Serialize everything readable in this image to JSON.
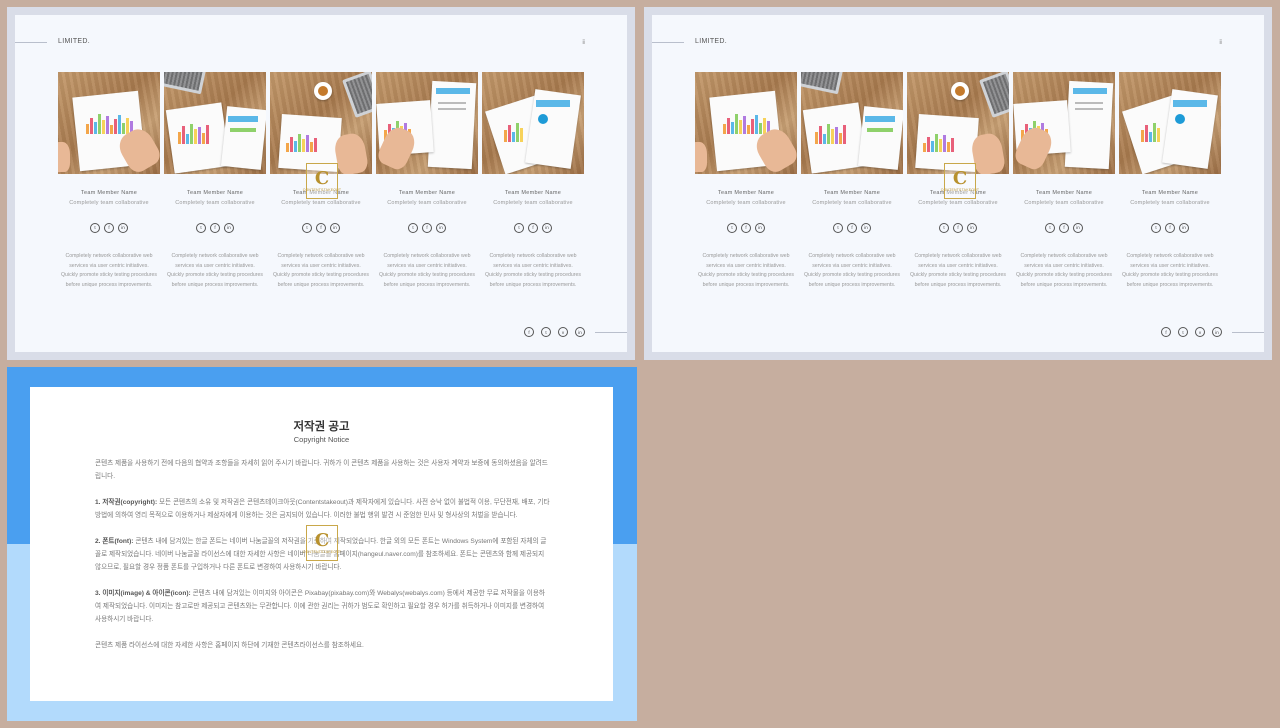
{
  "slides": [
    {
      "brand": "LIMITED.",
      "top_marker": "ⅱ",
      "members": [
        {
          "name": "Team Member Name",
          "role": "Completely team collaborative",
          "desc": "Completely network collaborative web services via user centric initiatives. Quickly promote sticky testing procedures before unique process improvements."
        },
        {
          "name": "Team Member Name",
          "role": "Completely team collaborative",
          "desc": "Completely network collaborative web services via user centric initiatives. Quickly promote sticky testing procedures before unique process improvements."
        },
        {
          "name": "Team Member Name",
          "role": "Completely team collaborative",
          "desc": "Completely network collaborative web services via user centric initiatives. Quickly promote sticky testing procedures before unique process improvements."
        },
        {
          "name": "Team Member Name",
          "role": "Completely team collaborative",
          "desc": "Completely network collaborative web services via user centric initiatives. Quickly promote sticky testing procedures before unique process improvements."
        },
        {
          "name": "Team Member Name",
          "role": "Completely team collaborative",
          "desc": "Completely network collaborative web services via user centric initiatives. Quickly promote sticky testing procedures before unique process improvements."
        }
      ]
    },
    {
      "brand": "LIMITED.",
      "top_marker": "ⅱ",
      "members": [
        {
          "name": "Team Member Name",
          "role": "Completely team collaborative",
          "desc": "Completely network collaborative web services via user centric initiatives. Quickly promote sticky testing procedures before unique process improvements."
        },
        {
          "name": "Team Member Name",
          "role": "Completely team collaborative",
          "desc": "Completely network collaborative web services via user centric initiatives. Quickly promote sticky testing procedures before unique process improvements."
        },
        {
          "name": "Team Member Name",
          "role": "Completely team collaborative",
          "desc": "Completely network collaborative web services via user centric initiatives. Quickly promote sticky testing procedures before unique process improvements."
        },
        {
          "name": "Team Member Name",
          "role": "Completely team collaborative",
          "desc": "Completely network collaborative web services via user centric initiatives. Quickly promote sticky testing procedures before unique process improvements."
        },
        {
          "name": "Team Member Name",
          "role": "Completely team collaborative",
          "desc": "Completely network collaborative web services via user centric initiatives. Quickly promote sticky testing procedures before unique process improvements."
        }
      ]
    }
  ],
  "icons": {
    "card_social": [
      "twitter-icon",
      "facebook-icon",
      "linkedin-icon"
    ],
    "card_social_glyphs": [
      "t",
      "f",
      "in"
    ],
    "bottom_social": [
      "facebook-icon",
      "twitter-icon",
      "vimeo-icon",
      "linkedin-icon"
    ],
    "bottom_social_glyphs": [
      "f",
      "t",
      "v",
      "in"
    ]
  },
  "watermark": {
    "letter": "C",
    "text": "CONTENTSTAKEOUT"
  },
  "colors": {
    "background": "#c6ae9f",
    "notice_top": "#4a9ff0",
    "notice_bottom": "#b2dafc",
    "watermark_gold": "#b8912e"
  },
  "notice": {
    "title": "저작권 공고",
    "subtitle": "Copyright Notice",
    "intro": "콘텐츠 제품을 사용하기 전에 다음의 협약과 조항들을 자세히 읽어 주시기 바랍니다. 귀하가 이 콘텐츠 제품을 사용하는 것은 사용자 계약과 보증에 동의하셨음을 알려드립니다.",
    "sec1_head": "1. 저작권(copyright):",
    "sec1_body": " 모든 콘텐츠의 소유 및 저작권은 콘텐츠테이크아웃(Contentstakeout)과 제작자에게 있습니다. 사전 승낙 없이 불법적 이용, 무단전재, 배포, 기타 방법에 의하여 영리 목적으로 이용하거나 제삼자에게 이용하는 것은 금지되어 있습니다. 이러한 불법 행위 발견 시 준엄한 민사 및 형사상의 처벌을 받습니다.",
    "sec2_head": "2. 폰트(font):",
    "sec2_body": " 콘텐츠 내에 담겨있는 한글 폰트는 네이버 나눔글꼴의 저작권을 기준하여 제작되었습니다. 한글 외의 모든 폰트는 Windows System에 포함된 자체의 글꼴로 제작되었습니다. 네이버 나눔글꼴 라이선스에 대한 자세한 사항은 네이버 나눔글꼴 홈페이지(hangeul.naver.com)를 참조하세요. 폰트는 콘텐츠와 함께 제공되지 않으므로, 필요할 경우 정품 폰트를 구입하거나 다른 폰트로 변경하여 사용하시기 바랍니다.",
    "sec3_head": "3. 이미지(image) & 아이콘(icon):",
    "sec3_body": " 콘텐츠 내에 담겨있는 이미지와 아이콘은 Pixabay(pixabay.com)와 Webalys(webalys.com) 등에서 제공한 무료 저작물을 이용하여 제작되었습니다. 이미지는 참고로만 제공되고 콘텐츠와는 무관합니다. 이에 관한 권리는 귀하가 범도로 확인하고 필요할 경우 허가를 취득하거나 이미지를 변경하여 사용하시기 바랍니다.",
    "outro": "콘텐츠 제품 라이선스에 대한 자세한 사항은 홈페이지 하단에 기재한 콘텐츠라이선스를 참조하세요."
  }
}
